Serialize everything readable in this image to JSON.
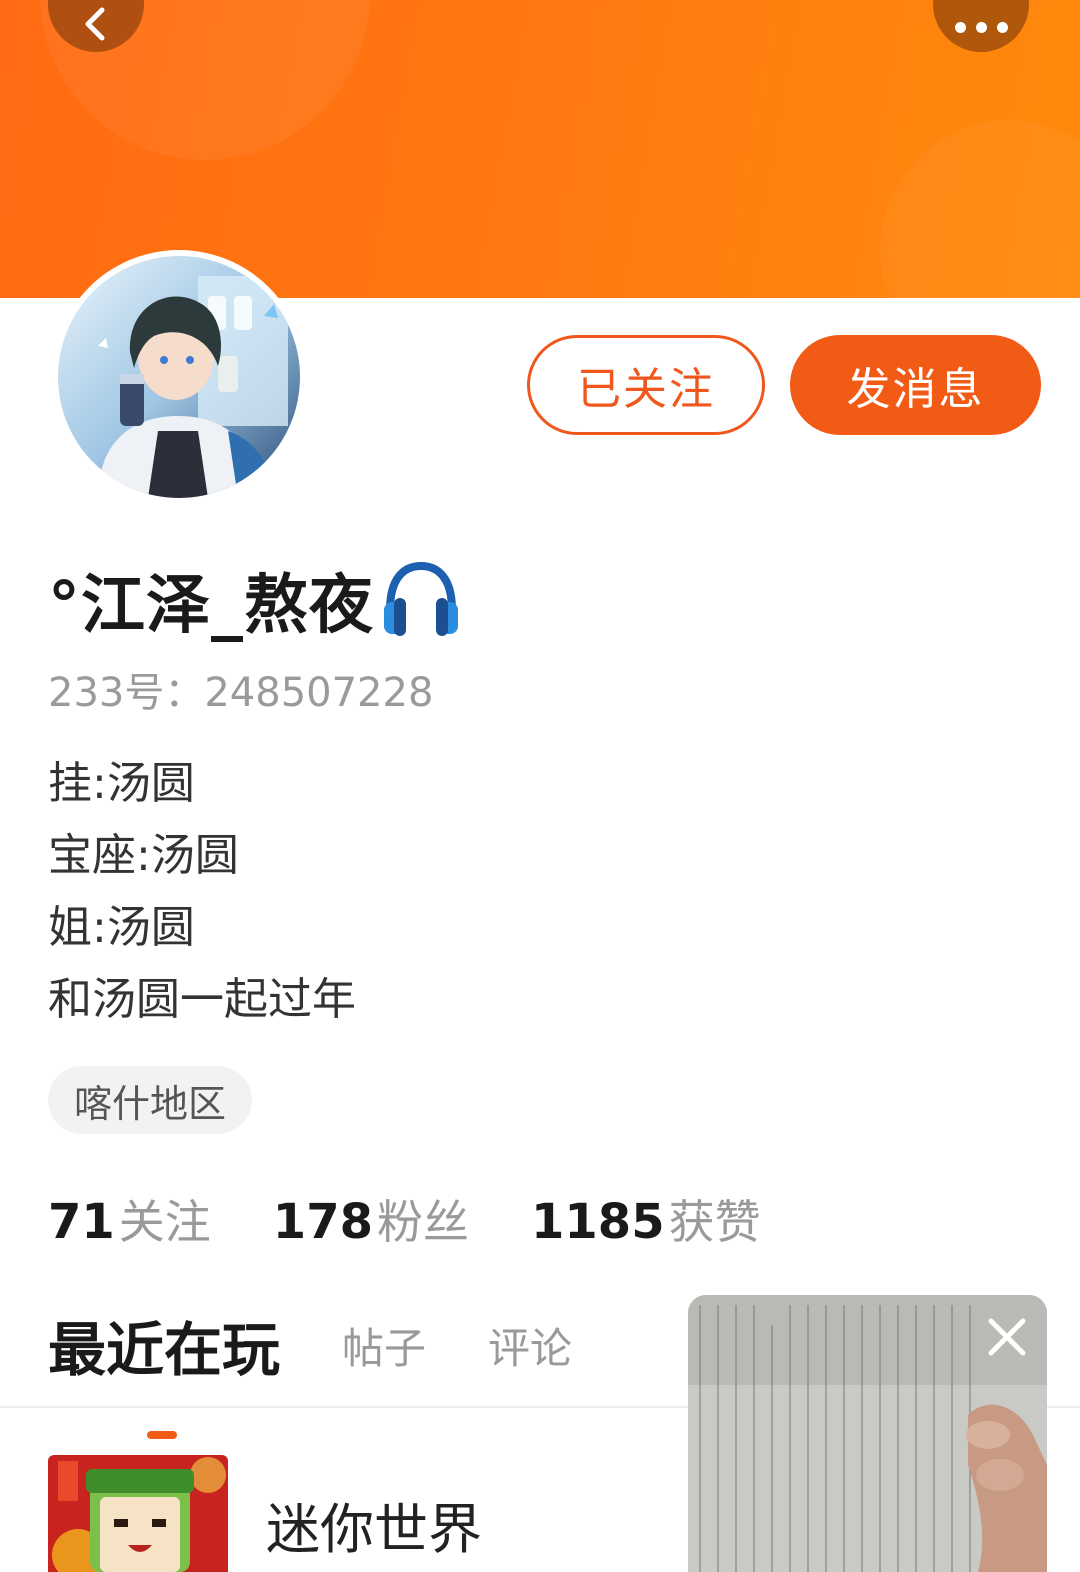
{
  "header": {
    "back_icon": "chevron-left-icon",
    "more_icon": "more-dots-icon"
  },
  "profile": {
    "follow_button": "已关注",
    "message_button": "发消息",
    "name": "°江泽_熬夜",
    "name_emoji": "headphones-icon",
    "uid": "233号：248507228",
    "bio": [
      "挂:汤圆",
      "宝座:汤圆",
      "姐:汤圆",
      "和汤圆一起过年"
    ],
    "region": "喀什地区"
  },
  "stats": [
    {
      "num": "71",
      "label": "关注"
    },
    {
      "num": "178",
      "label": "粉丝"
    },
    {
      "num": "1185",
      "label": "获赞"
    }
  ],
  "tabs": {
    "active": "最近在玩",
    "items": [
      "帖子",
      "评论"
    ]
  },
  "games": [
    {
      "name": "迷你世界"
    }
  ],
  "floating_video": {
    "close_icon": "close-icon"
  },
  "colors": {
    "accent": "#f25b16",
    "banner": "#ff7a10",
    "muted_text": "#9a9a9a"
  }
}
